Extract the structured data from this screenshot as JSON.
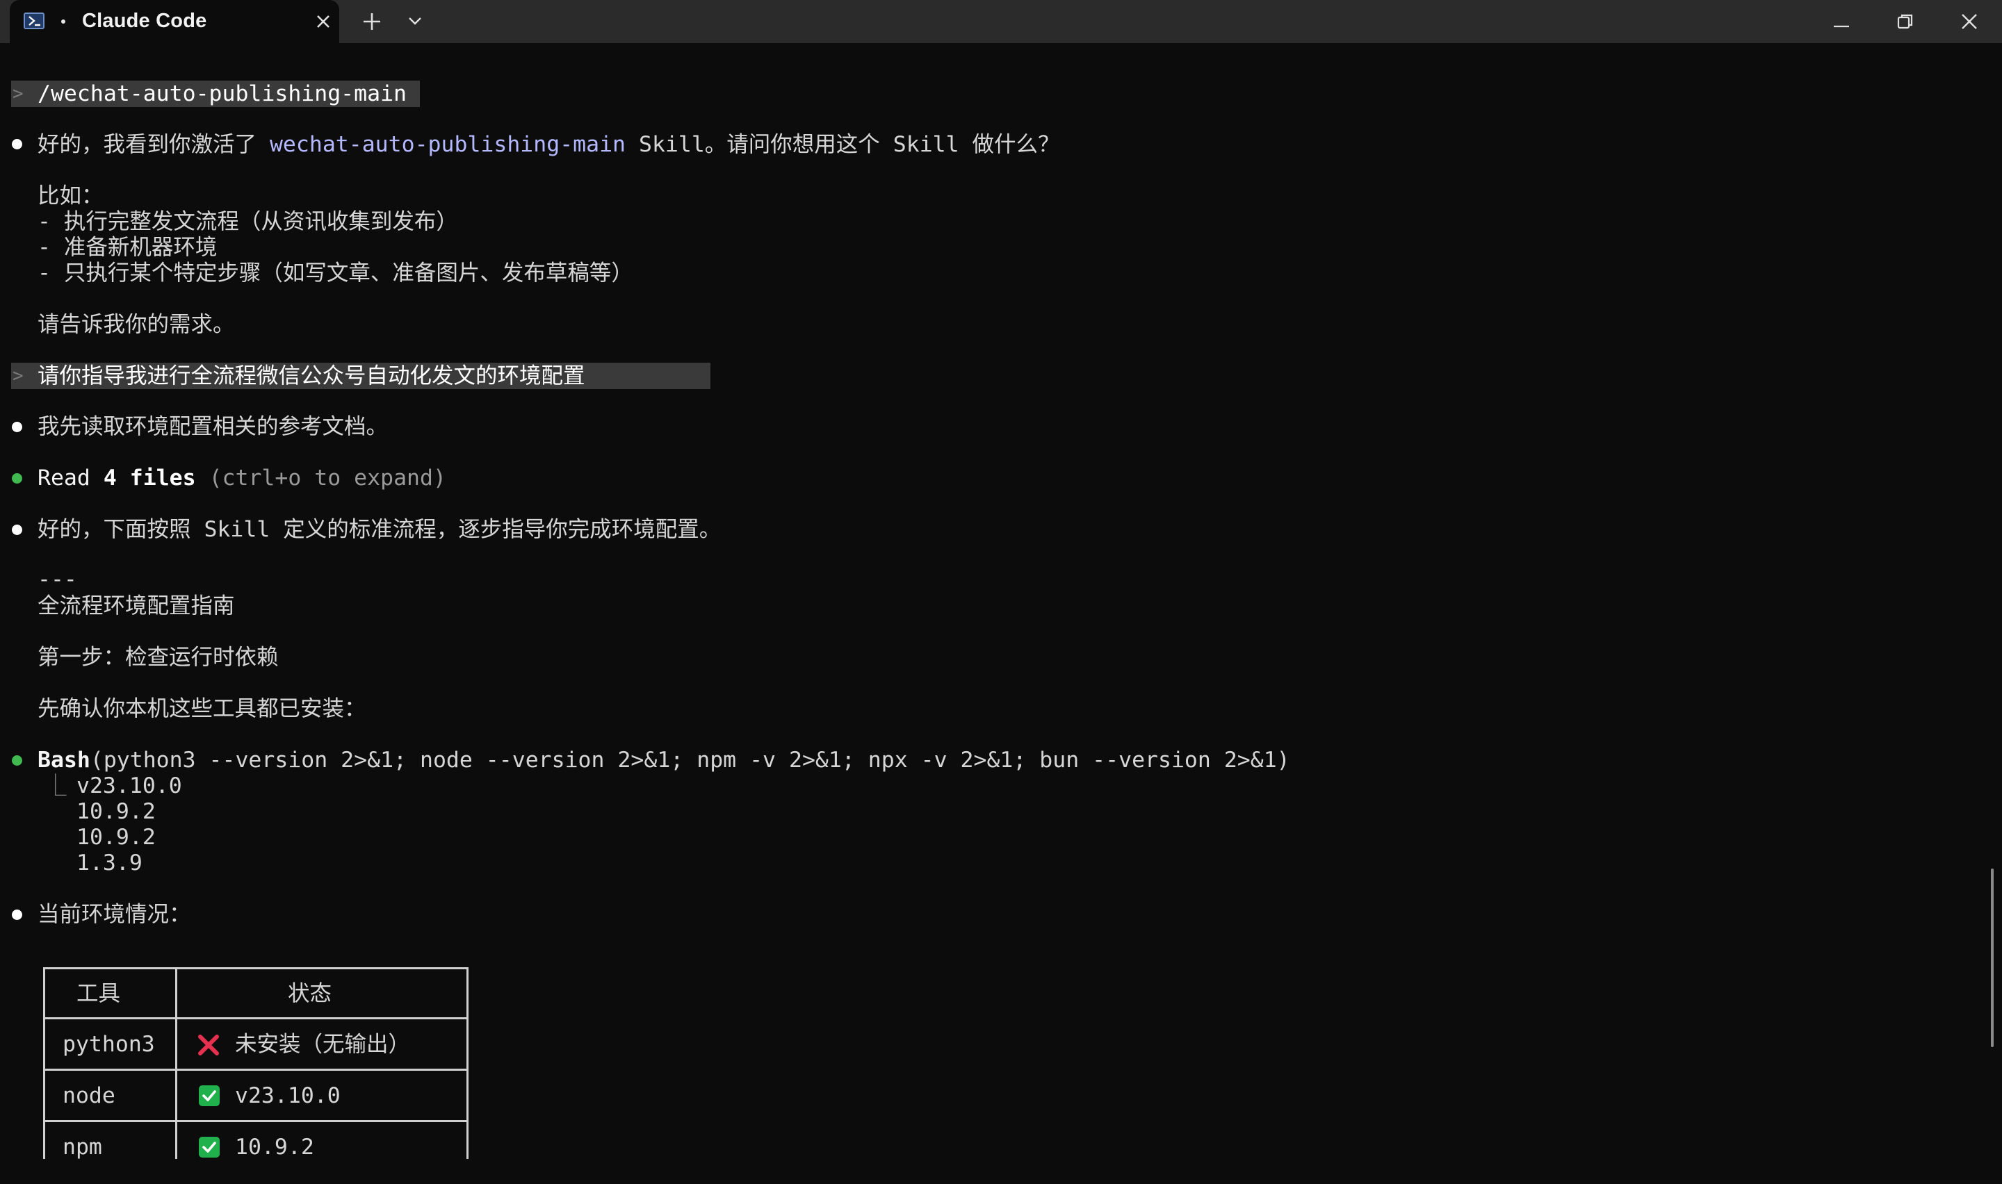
{
  "window": {
    "tab_title": "Claude Code",
    "tab_icon": "powershell-icon",
    "controls": [
      "minimize-icon",
      "restore-icon",
      "close-icon"
    ]
  },
  "conversation": {
    "prompt1": "/wechat-auto-publishing-main",
    "reply1_prefix": "好的，我看到你激活了 ",
    "reply1_skill": "wechat-auto-publishing-main",
    "reply1_suffix": " Skill。请问你想用这个 Skill 做什么？",
    "examples_heading": "比如：",
    "example1": "- 执行完整发文流程（从资讯收集到发布）",
    "example2": "- 准备新机器环境",
    "example3": "- 只执行某个特定步骤（如写文章、准备图片、发布草稿等）",
    "ask_need": "请告诉我你的需求。",
    "prompt2": "请你指导我进行全流程微信公众号自动化发文的环境配置",
    "reply2": "我先读取环境配置相关的参考文档。",
    "read_label": "Read",
    "read_count": "4",
    "read_unit": "files",
    "read_hint": "(ctrl+o to expand)",
    "reply3": "好的，下面按照 Skill 定义的标准流程，逐步指导你完成环境配置。",
    "separator": "---",
    "guide_title": "全流程环境配置指南",
    "step1": "第一步：检查运行时依赖",
    "confirm_tools": "先确认你本机这些工具都已安装：",
    "bash_tool": "Bash",
    "bash_command": "(python3 --version 2>&1; node --version 2>&1; npm -v 2>&1; npx -v 2>&1; bun --version 2>&1)",
    "bash_output": [
      "v23.10.0",
      "10.9.2",
      "10.9.2",
      "1.3.9"
    ],
    "env_status": "当前环境情况："
  },
  "env_table": {
    "headers": [
      "工具",
      "状态"
    ],
    "rows": [
      {
        "tool": "python3",
        "icon": "cross-mark-icon",
        "status": "未安装（无输出）"
      },
      {
        "tool": "node",
        "icon": "check-box-icon",
        "status": "v23.10.0"
      },
      {
        "tool": "npm",
        "icon": "check-box-icon",
        "status": "10.9.2"
      }
    ]
  },
  "colors": {
    "background": "#0c0c0c",
    "titlebar": "#2b2b2b",
    "skill_link": "#b4b8ff",
    "bullet_green": "#3fb950",
    "check_green": "#21b14c",
    "cross_red": "#e5304f"
  }
}
